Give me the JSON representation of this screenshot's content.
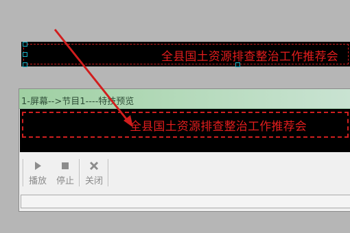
{
  "led": {
    "text": "全县国土资源排查整治工作推荐会"
  },
  "preview": {
    "title": "1-屏幕-->节目1----特技预览",
    "screen_text": "全县国土资源排查整治工作推荐会",
    "toolbar": [
      {
        "label": "播放",
        "icon": "play-icon"
      },
      {
        "label": "停止",
        "icon": "stop-icon"
      },
      {
        "label": "关闭",
        "icon": "close-icon"
      }
    ],
    "status_text": ""
  },
  "colors": {
    "led_text": "#e21d1d",
    "dashed_frame": "#d21f1f",
    "arrow": "#d11d1d",
    "titlebar": "#b9dcc0"
  }
}
